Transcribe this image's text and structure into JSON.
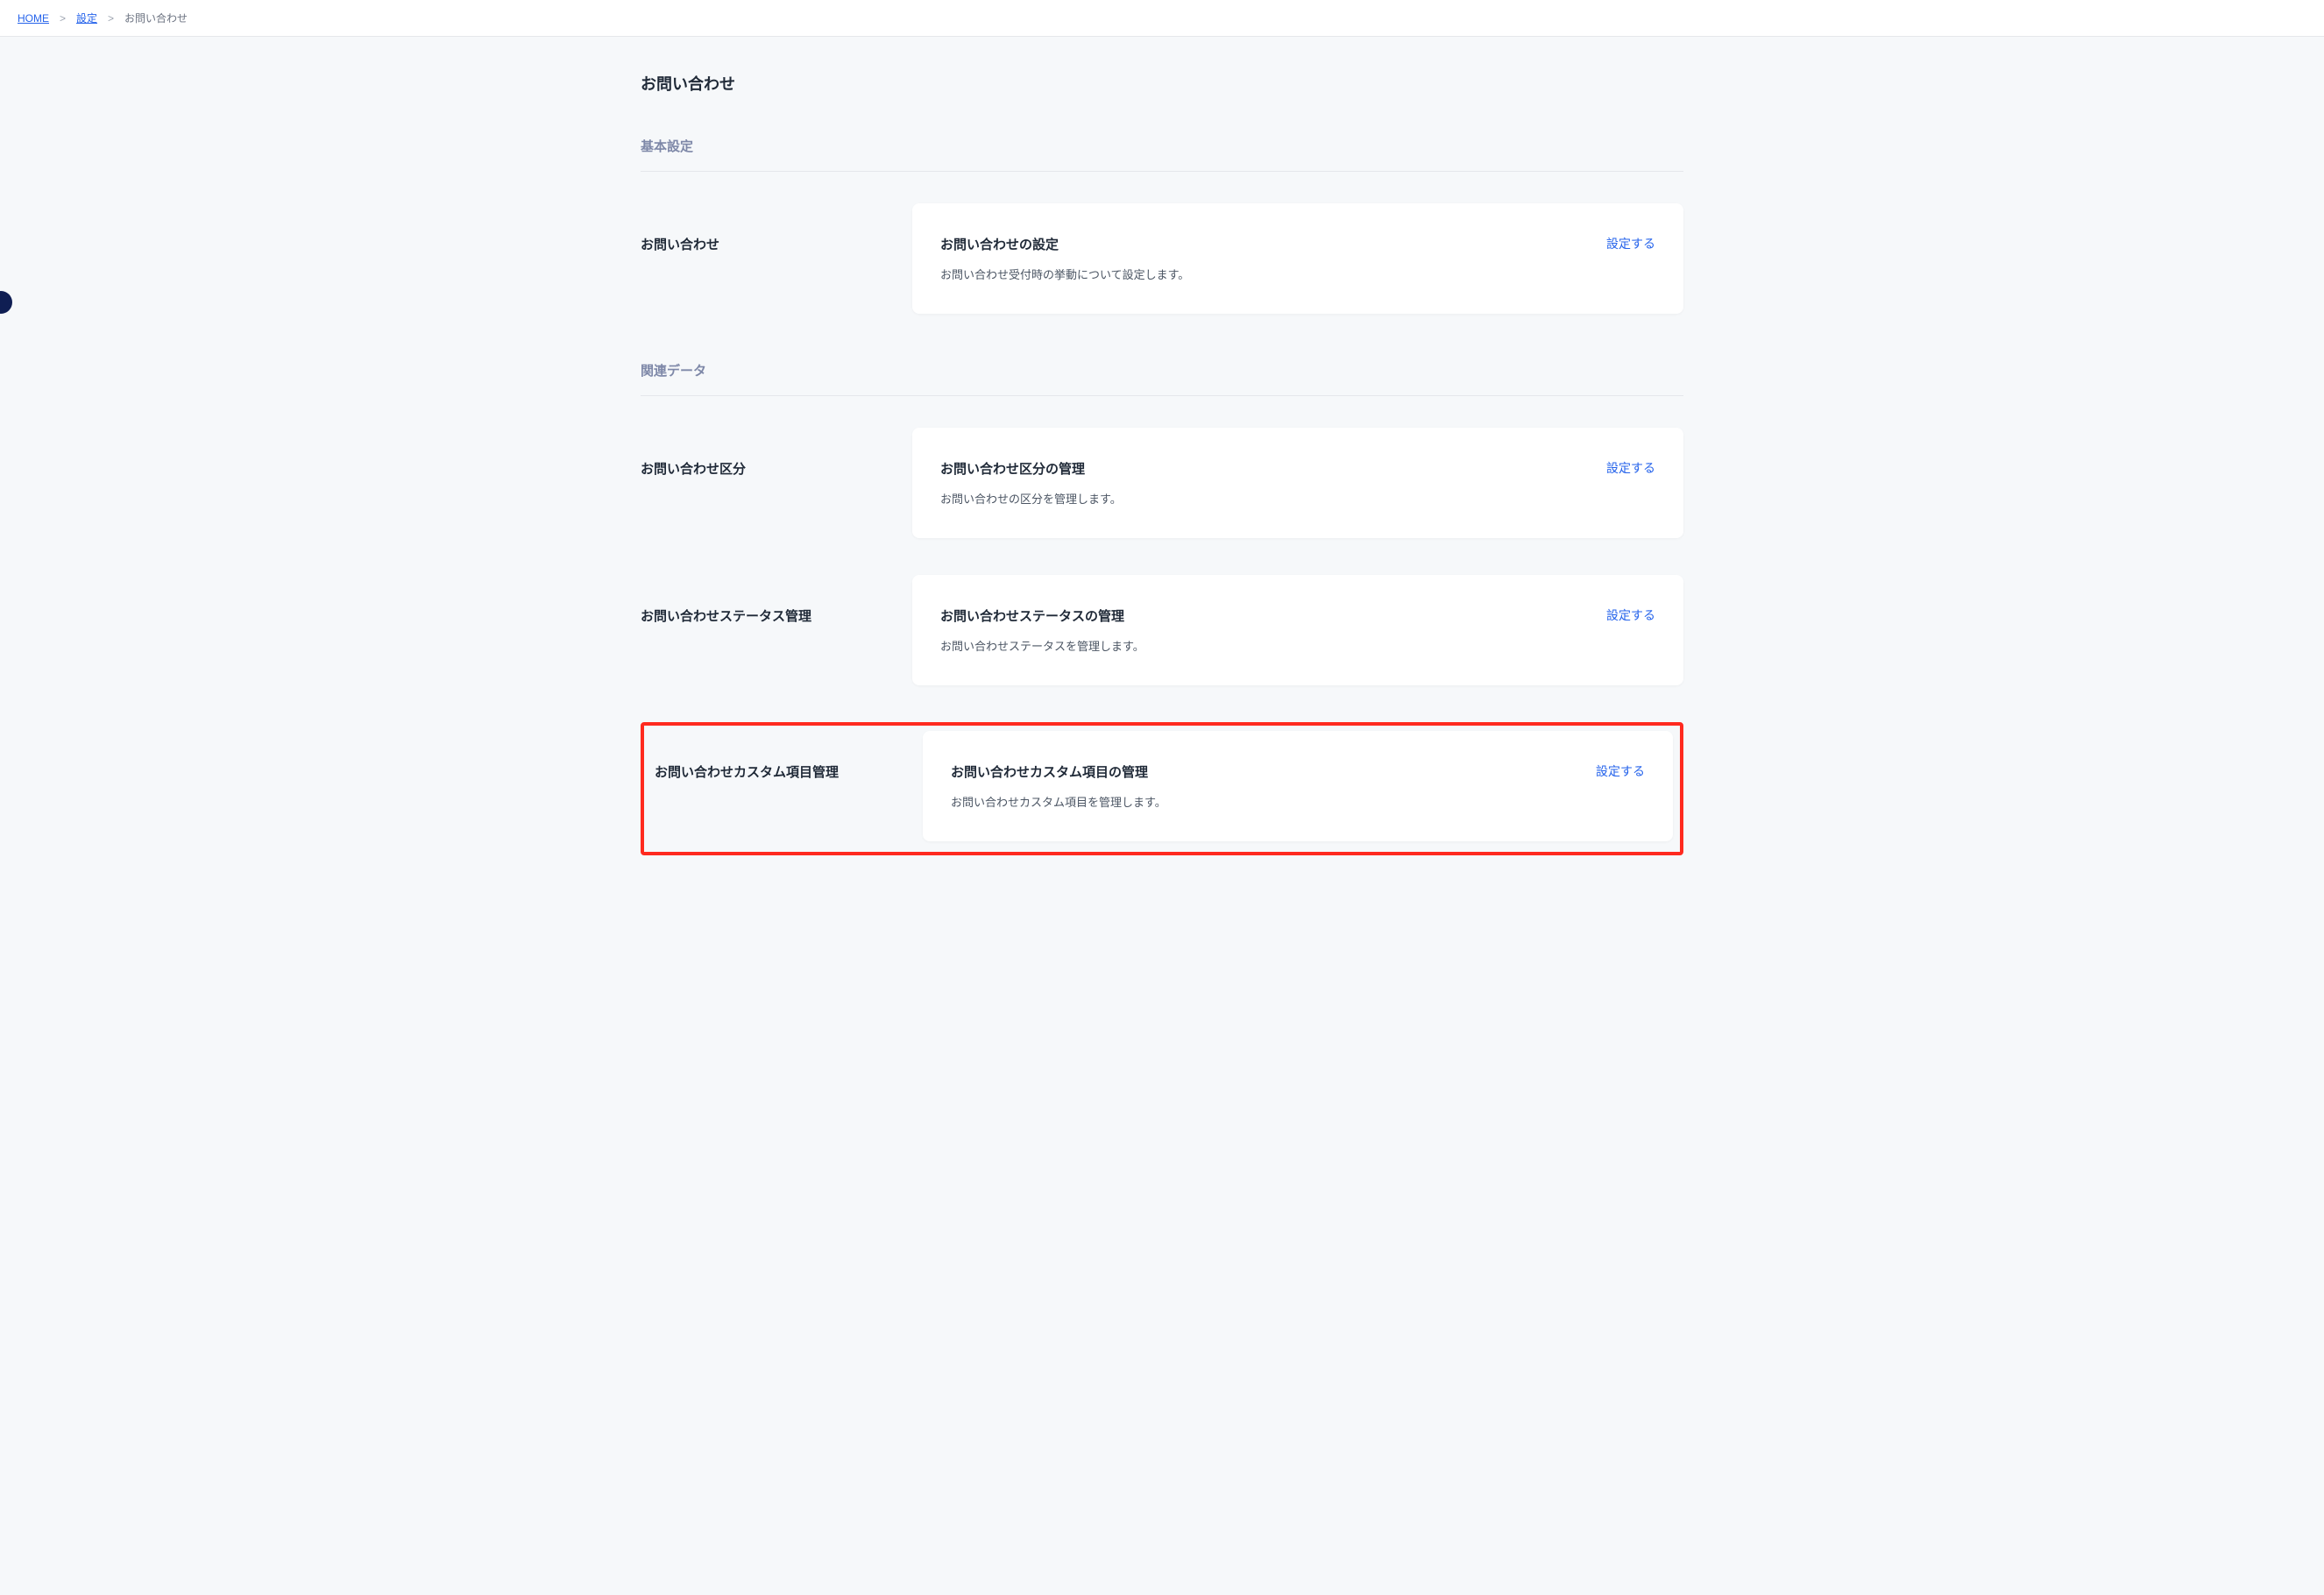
{
  "breadcrumb": {
    "home": "HOME",
    "settings": "設定",
    "current": "お問い合わせ"
  },
  "page": {
    "title": "お問い合わせ"
  },
  "sections": {
    "basic": {
      "header": "基本設定",
      "items": [
        {
          "label": "お問い合わせ",
          "card_title": "お問い合わせの設定",
          "card_desc": "お問い合わせ受付時の挙動について設定します。",
          "action": "設定する"
        }
      ]
    },
    "related": {
      "header": "関連データ",
      "items": [
        {
          "label": "お問い合わせ区分",
          "card_title": "お問い合わせ区分の管理",
          "card_desc": "お問い合わせの区分を管理します。",
          "action": "設定する"
        },
        {
          "label": "お問い合わせステータス管理",
          "card_title": "お問い合わせステータスの管理",
          "card_desc": "お問い合わせステータスを管理します。",
          "action": "設定する"
        },
        {
          "label": "お問い合わせカスタム項目管理",
          "card_title": "お問い合わせカスタム項目の管理",
          "card_desc": "お問い合わせカスタム項目を管理します。",
          "action": "設定する"
        }
      ]
    }
  }
}
